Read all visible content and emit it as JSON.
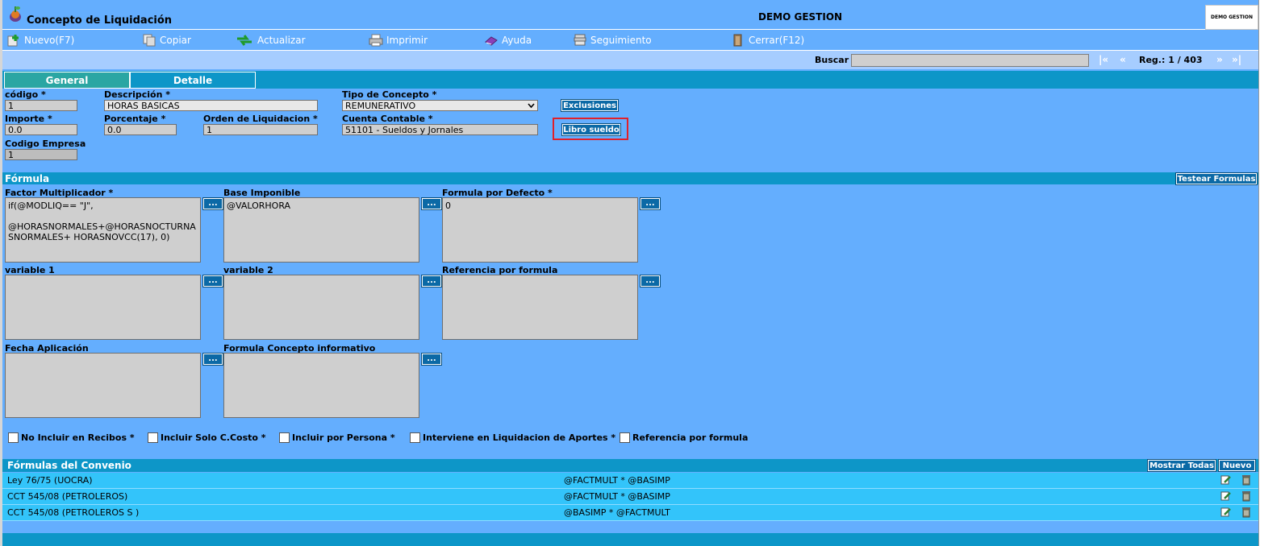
{
  "header": {
    "title": "Concepto de Liquidación",
    "company": "DEMO GESTION",
    "logo_text": "DEMO GESTION"
  },
  "toolbar": [
    {
      "label": "Nuevo(F7)",
      "icon": "new-icon"
    },
    {
      "label": "Copiar",
      "icon": "copy-icon"
    },
    {
      "label": "Actualizar",
      "icon": "refresh-icon"
    },
    {
      "label": "Imprimir",
      "icon": "print-icon"
    },
    {
      "label": "Ayuda",
      "icon": "help-icon"
    },
    {
      "label": "Seguimiento",
      "icon": "tracking-icon"
    },
    {
      "label": "Cerrar(F12)",
      "icon": "close-icon"
    }
  ],
  "search": {
    "label": "Buscar",
    "value": "",
    "first": "|«",
    "prev": "«",
    "record": "Reg.: 1 / 403",
    "next": "»",
    "last": "»|"
  },
  "tabs": [
    "General",
    "Detalle"
  ],
  "form": {
    "codigo_label": "código *",
    "codigo": "1",
    "descripcion_label": "Descripción *",
    "descripcion": "HORAS BASICAS",
    "tipo_label": "Tipo de Concepto *",
    "tipo": "REMUNERATIVO",
    "exclusiones": "Exclusiones",
    "importe_label": "Importe *",
    "importe": "0.0",
    "porcentaje_label": "Porcentaje *",
    "porcentaje": "0.0",
    "orden_label": "Orden de Liquidacion *",
    "orden": "1",
    "cuenta_label": "Cuenta Contable *",
    "cuenta": "51101 - Sueldos y Jornales",
    "libro_sueldo": "Libro sueldo",
    "empresa_label": "Codigo Empresa",
    "empresa": "1"
  },
  "formula": {
    "section_title": "Fórmula",
    "test_button": "Testear Formulas",
    "dots": "...",
    "factor_label": "Factor Multiplicador *",
    "factor": "if(@MODLIQ== \"J\",\n\n@HORASNORMALES+@HORASNOCTURNA\nSNORMALES+ HORASNOVCC(17), 0)",
    "base_label": "Base Imponible",
    "base": "@VALORHORA",
    "defecto_label": "Formula por Defecto *",
    "defecto": "0",
    "var1_label": "variable 1",
    "var1": "",
    "var2_label": "variable 2",
    "var2": "",
    "ref_label": "Referencia por formula",
    "ref": "",
    "fecha_label": "Fecha Aplicación",
    "fecha": "",
    "informativo_label": "Formula Concepto informativo",
    "informativo": ""
  },
  "checkboxes": [
    "No Incluir en Recibos *",
    "Incluir Solo C.Costo *",
    "Incluir por Persona *",
    "Interviene en Liquidacion de Aportes *",
    "Referencia por formula"
  ],
  "convenio": {
    "title": "Fórmulas del Convenio",
    "show_all": "Mostrar Todas",
    "new": "Nuevo",
    "rows": [
      {
        "name": "Ley 76/75 (UOCRA)",
        "formula": "@FACTMULT * @BASIMP"
      },
      {
        "name": "CCT 545/08 (PETROLEROS)",
        "formula": "@FACTMULT * @BASIMP"
      },
      {
        "name": "CCT 545/08 (PETROLEROS S )",
        "formula": "@BASIMP * @FACTMULT"
      }
    ]
  },
  "colors": {
    "background": "#64aefe",
    "section": "#0d96c8",
    "button": "#0b69a6",
    "highlight": "#e0202a"
  }
}
